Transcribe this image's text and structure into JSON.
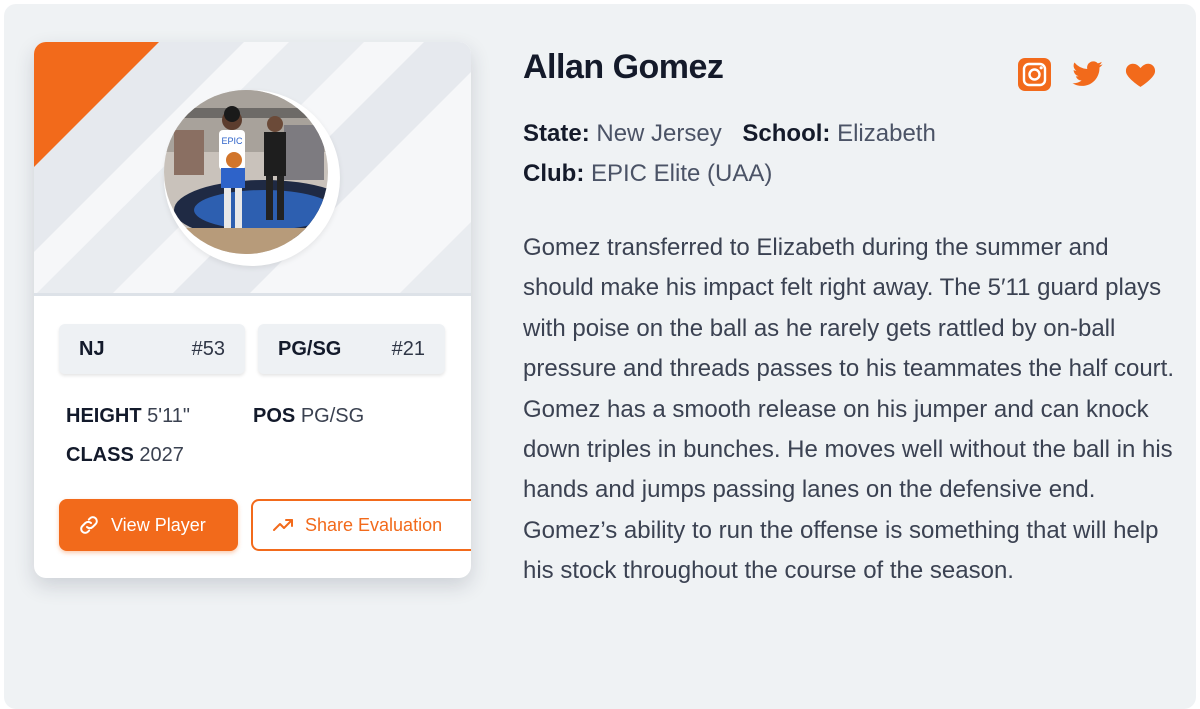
{
  "player": {
    "name": "Allan Gomez",
    "state_label": "State:",
    "state": "New Jersey",
    "school_label": "School:",
    "school": "Elizabeth",
    "club_label": "Club:",
    "club": "EPIC Elite (UAA)",
    "bio": "Gomez transferred to Elizabeth during the summer and should make his impact felt right away. The 5′11 guard plays with poise on the ball as he rarely gets rattled by on-ball pressure and threads passes to his teammates the half court. Gomez has a smooth release on his jumper and can knock down triples in bunches. He moves well without the ball in his hands and jumps passing lanes on the defensive end. Gomez’s ability to run the offense is something that will help his stock throughout the course of the season."
  },
  "card": {
    "avatar_jersey_text": "EPIC",
    "chips": {
      "state": {
        "label": "NJ",
        "rank": "#53"
      },
      "position": {
        "label": "PG/SG",
        "rank": "#21"
      }
    },
    "stats": {
      "height_label": "HEIGHT",
      "height": "5'11\"",
      "pos_label": "POS",
      "pos": "PG/SG",
      "class_label": "CLASS",
      "class": "2027"
    },
    "buttons": {
      "view_player": "View Player",
      "share_evaluation": "Share Evaluation"
    }
  },
  "socials": [
    "instagram-icon",
    "twitter-icon",
    "heart-icon"
  ],
  "colors": {
    "accent": "#f26a1b",
    "background": "#eff2f4",
    "text_dark": "#141a2a",
    "text_muted": "#4b5366"
  }
}
